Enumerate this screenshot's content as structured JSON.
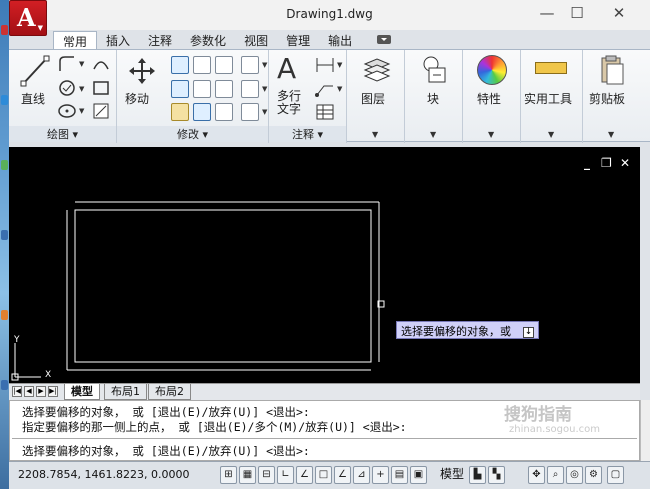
{
  "window": {
    "title": "Drawing1.dwg",
    "controls": {
      "minimize": "—",
      "maximize": "☐",
      "close": "✕"
    }
  },
  "ribbon": {
    "tabs": [
      "常用",
      "插入",
      "注释",
      "参数化",
      "视图",
      "管理",
      "输出"
    ],
    "active_tab": "常用",
    "panels": {
      "draw": {
        "title": "绘图 ▾",
        "line_label": "直线"
      },
      "modify": {
        "title": "修改 ▾",
        "move_label": "移动"
      },
      "annotation": {
        "title": "注释 ▾",
        "mtext_label_1": "多行",
        "mtext_label_2": "文字"
      },
      "layers": {
        "label": "图层"
      },
      "block": {
        "label": "块"
      },
      "properties": {
        "label": "特性"
      },
      "utilities": {
        "label": "实用工具"
      },
      "clipboard": {
        "label": "剪贴板"
      }
    }
  },
  "canvas": {
    "controls": {
      "minimize": "_",
      "restore": "❐",
      "close": "✕"
    },
    "ucs": {
      "x": "X",
      "y": "Y"
    },
    "tooltip": {
      "text": "选择要偏移的对象，或",
      "button": "↓"
    }
  },
  "layout_tabs": [
    "模型",
    "布局1",
    "布局2"
  ],
  "command": {
    "lines": [
      "选择要偏移的对象，  或  [退出(E)/放弃(U)]  <退出>:",
      "指定要偏移的那一侧上的点，  或  [退出(E)/多个(M)/放弃(U)]  <退出>:",
      "选择要偏移的对象，  或  [退出(E)/放弃(U)]  <退出>:"
    ],
    "watermark": "搜狗指南",
    "watermark_url": "zhinan.sogou.com"
  },
  "status": {
    "coords": "2208.7854,  1461.8223,  0.0000",
    "model_label": "模型"
  }
}
